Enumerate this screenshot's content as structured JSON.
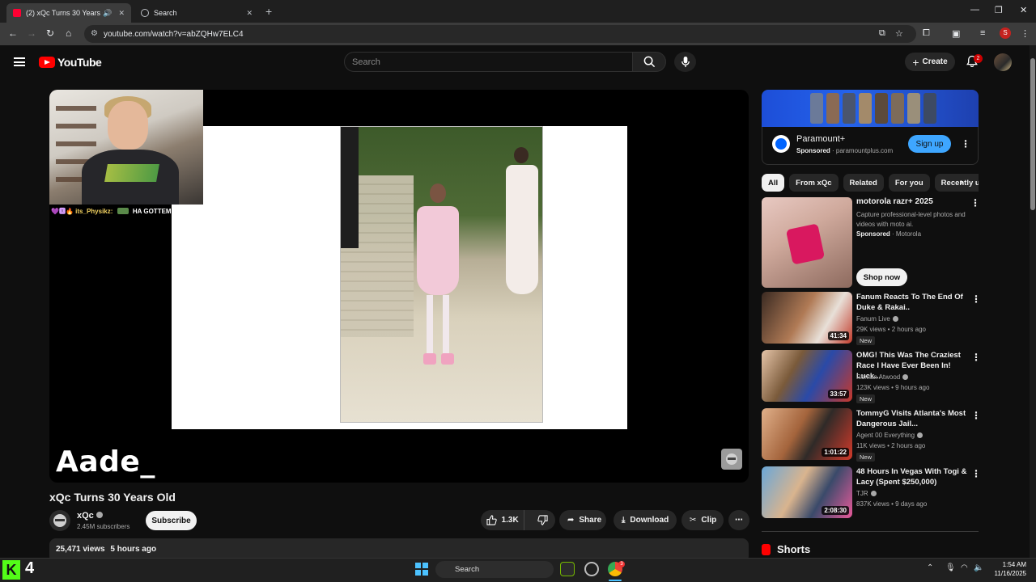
{
  "browser": {
    "tabs": [
      {
        "title": "(2) xQc Turns 30 Years Old",
        "active": true
      },
      {
        "title": "Search",
        "active": false
      }
    ],
    "url": "youtube.com/watch?v=abZQHw7ELC4",
    "profile_initial": "S"
  },
  "masthead": {
    "logo_text": "YouTube",
    "search_placeholder": "Search",
    "create_label": "Create",
    "notification_count": "2"
  },
  "player": {
    "chat_emotes": "💜🆇🔥",
    "chat_user": "its_Physikz:",
    "chat_message": "HA GOTTEM",
    "overlay_text": "Aade_"
  },
  "video": {
    "title": "xQc Turns 30 Years Old",
    "channel": "xQc",
    "subscribers": "2.45M subscribers",
    "subscribe_label": "Subscribe",
    "likes": "1.3K",
    "share_label": "Share",
    "download_label": "Download",
    "clip_label": "Clip",
    "views": "25,471 views",
    "age": "5 hours ago"
  },
  "ad_top": {
    "name": "Paramount+",
    "sponsored": "Sponsored",
    "domain": "paramountplus.com",
    "cta": "Sign up"
  },
  "chips": [
    "All",
    "From xQc",
    "Related",
    "For you",
    "Recently uploaded"
  ],
  "ad_side": {
    "title": "motorola razr+ 2025",
    "description": "Capture professional-level photos and videos with moto ai.",
    "sponsored": "Sponsored",
    "advertiser": "Motorola",
    "cta": "Shop now"
  },
  "recommendations": [
    {
      "title": "Fanum Reacts To The End Of Duke & Rakai..",
      "channel": "Fanum Live",
      "meta": "29K views • 2 hours ago",
      "duration": "41:34",
      "badge": "New"
    },
    {
      "title": "OMG! This Was The Craziest Race I Have Ever Been In! Luck...",
      "channel": "Roman Atwood",
      "meta": "123K views • 9 hours ago",
      "duration": "33:57",
      "badge": "New"
    },
    {
      "title": "TommyG Visits Atlanta's Most Dangerous Jail...",
      "channel": "Agent 00 Everything",
      "meta": "11K views • 2 hours ago",
      "duration": "1:01:22",
      "badge": "New"
    },
    {
      "title": "48 Hours In Vegas With Togi & Lacy (Spent $250,000)",
      "channel": "TJR",
      "meta": "837K views • 9 days ago",
      "duration": "2:08:30",
      "badge": ""
    }
  ],
  "shorts_label": "Shorts",
  "taskbar": {
    "kick_count": "4",
    "search_placeholder": "Search",
    "time": "1:54 AM",
    "date": "11/16/2025",
    "chrome_badge": "3"
  }
}
